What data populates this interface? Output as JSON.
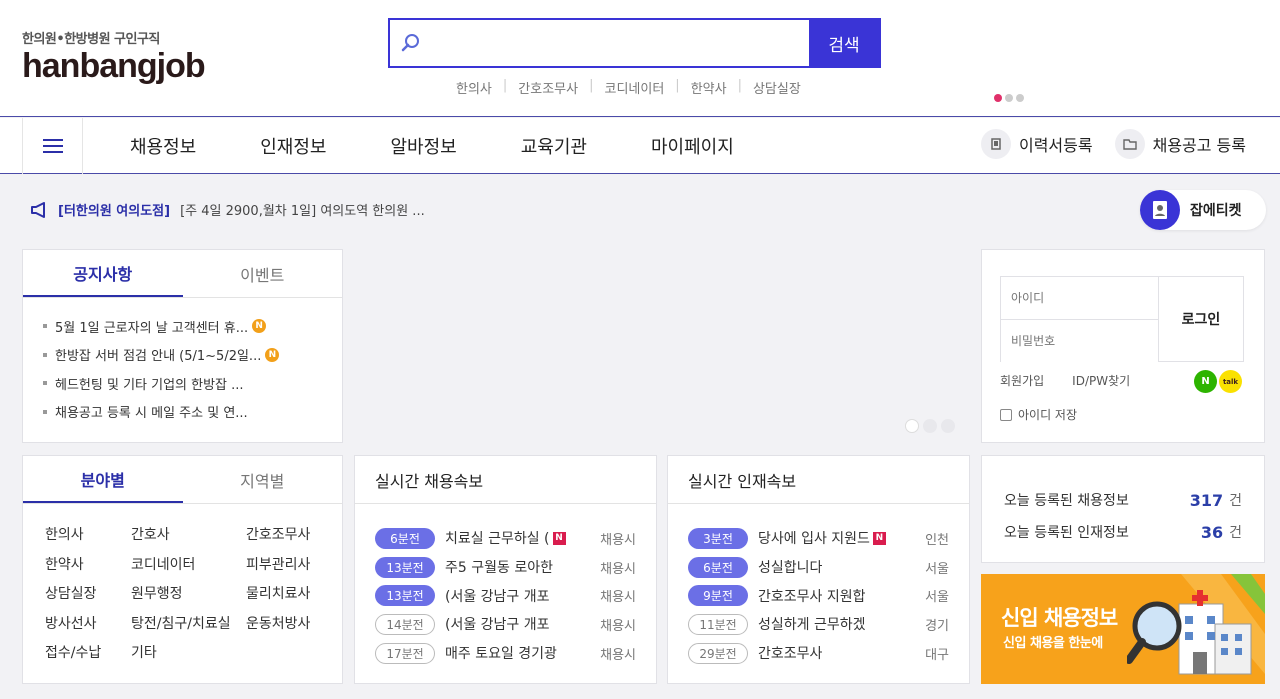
{
  "header": {
    "logo_sub": "한의원•한방병원 구인구직",
    "logo_main": "hanbangjob",
    "search_placeholder": "",
    "search_button": "검색",
    "quick_links": [
      "한의사",
      "간호조무사",
      "코디네이터",
      "한약사",
      "상담실장"
    ]
  },
  "nav": {
    "items": [
      "채용정보",
      "인재정보",
      "알바정보",
      "교육기관",
      "마이페이지"
    ],
    "resume_register": "이력서등록",
    "job_register": "채용공고 등록"
  },
  "ticker": {
    "tag": "[터한의원 여의도점]",
    "text": "[주 4일 2900,월차 1일] 여의도역 한의원 ..."
  },
  "jobticket": {
    "label": "잡에티켓"
  },
  "notice": {
    "tabs": [
      "공지사항",
      "이벤트"
    ],
    "items": [
      {
        "text": "5월 1일 근로자의 날 고객센터 휴...",
        "badge": "N"
      },
      {
        "text": "한방잡 서버 점검 안내 (5/1~5/2일...",
        "badge": "N"
      },
      {
        "text": "헤드헌팅 및 기타 기업의 한방잡 ...",
        "badge": ""
      },
      {
        "text": "채용공고 등록 시 메일 주소 및 연...",
        "badge": ""
      }
    ]
  },
  "login": {
    "id_placeholder": "아이디",
    "pw_placeholder": "비밀번호",
    "login_button": "로그인",
    "signup": "회원가입",
    "find": "ID/PW찾기",
    "naver": "N",
    "kakao": "talk",
    "save_id": "아이디 저장"
  },
  "category": {
    "tabs": [
      "분야별",
      "지역별"
    ],
    "items": [
      "한의사",
      "간호사",
      "간호조무사",
      "한약사",
      "코디네이터",
      "피부관리사",
      "상담실장",
      "원무행정",
      "물리치료사",
      "방사선사",
      "탕전/침구/치료실",
      "운동처방사",
      "접수/수납",
      "기타"
    ]
  },
  "realtime_jobs": {
    "title": "실시간 채용속보",
    "items": [
      {
        "time": "6분전",
        "text": "치료실 근무하실 (",
        "new": "N",
        "loc": "채용시",
        "filled": true
      },
      {
        "time": "13분전",
        "text": "주5 구월동 로아한",
        "new": "",
        "loc": "채용시",
        "filled": true
      },
      {
        "time": "13분전",
        "text": "(서울 강남구 개포",
        "new": "",
        "loc": "채용시",
        "filled": true
      },
      {
        "time": "14분전",
        "text": "(서울 강남구 개포",
        "new": "",
        "loc": "채용시",
        "filled": false
      },
      {
        "time": "17분전",
        "text": "매주 토요일 경기광",
        "new": "",
        "loc": "채용시",
        "filled": false
      }
    ]
  },
  "realtime_talent": {
    "title": "실시간 인재속보",
    "items": [
      {
        "time": "3분전",
        "text": "당사에 입사 지원드",
        "new": "N",
        "loc": "인천",
        "filled": true
      },
      {
        "time": "6분전",
        "text": "성실합니다",
        "new": "",
        "loc": "서울",
        "filled": true
      },
      {
        "time": "9분전",
        "text": "간호조무사 지원합",
        "new": "",
        "loc": "서울",
        "filled": true
      },
      {
        "time": "11분전",
        "text": "성실하게 근무하겠",
        "new": "",
        "loc": "경기",
        "filled": false
      },
      {
        "time": "29분전",
        "text": "간호조무사",
        "new": "",
        "loc": "대구",
        "filled": false
      }
    ]
  },
  "stats": {
    "jobs_label": "오늘 등록된 채용정보",
    "jobs_count": "317",
    "talent_label": "오늘 등록된 인재정보",
    "talent_count": "36",
    "unit": "건"
  },
  "newjob_banner": {
    "title": "신입 채용정보",
    "subtitle": "신입 채용을 한눈에"
  },
  "colors": {
    "primary": "#3a34d6",
    "accent": "#2b2fa8",
    "badge": "#6b6fe6",
    "banner": "#f7a21b"
  }
}
